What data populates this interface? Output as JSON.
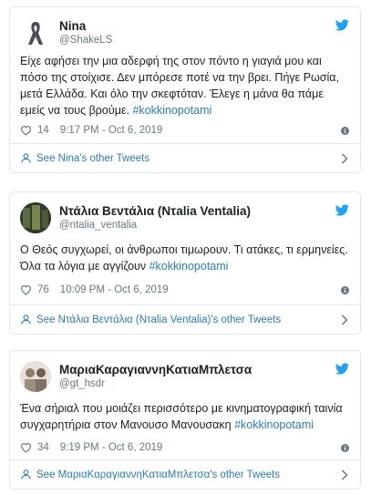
{
  "tweets": [
    {
      "name": "Nina",
      "handle": "@ShakeLS",
      "text": "Είχε αφήσει την μια αδερφή της στον πόντο η γιαγιά μου και πόσο της στοίχισε. Δεν μπόρεσε ποτέ να την βρει. Πήγε Ρωσία, μετά Ελλάδα. Και όλο την σκεφτόταν. Έλεγε η μάνα θα πάμε εμείς να τους βρούμε.",
      "hashtag": "#kokkinopotami",
      "likes": "14",
      "time": "9:17 PM - Oct 6, 2019",
      "footer": "See Nina's other Tweets"
    },
    {
      "name": "Ντάλια Βεντάλια (Nτalia Ventalia)",
      "handle": "@ntalia_ventalia",
      "text": "Ο Θεός συγχωρεί, οι άνθρωποι τιμωρουν. Τι ατάκες, τι ερμηνείες. Όλα τα λόγια με αγγίζουν",
      "hashtag": "#kokkinopotami",
      "likes": "76",
      "time": "10:09 PM - Oct 6, 2019",
      "footer": "See Ντάλια Βεντάλια (Nτalia Ventalia)'s other Tweets"
    },
    {
      "name": "ΜαριαΚαραγιαννηΚατιαΜπλετσα",
      "handle": "@gt_hsdr",
      "text": "Ένα σήριαλ που μοιάζει περισσότερο με κινηματογραφική ταινία συγχαρητήρια στον Μανουσο Μανουσακη ",
      "hashtag": "#kokkinopotami",
      "likes": "34",
      "time": "9:19 PM - Oct 6, 2019",
      "footer": "See ΜαριαΚαραγιαννηΚατιαΜπλετσα's other Tweets"
    }
  ],
  "icons": {
    "brand": "twitter-bird-icon",
    "like": "heart-icon",
    "info": "info-icon",
    "profile": "person-icon",
    "more": "chevron-right-icon"
  },
  "colors": {
    "link": "#2b7bb9",
    "twitter_blue": "#1da1f2",
    "muted": "#697882",
    "border": "#e1e8ed"
  }
}
